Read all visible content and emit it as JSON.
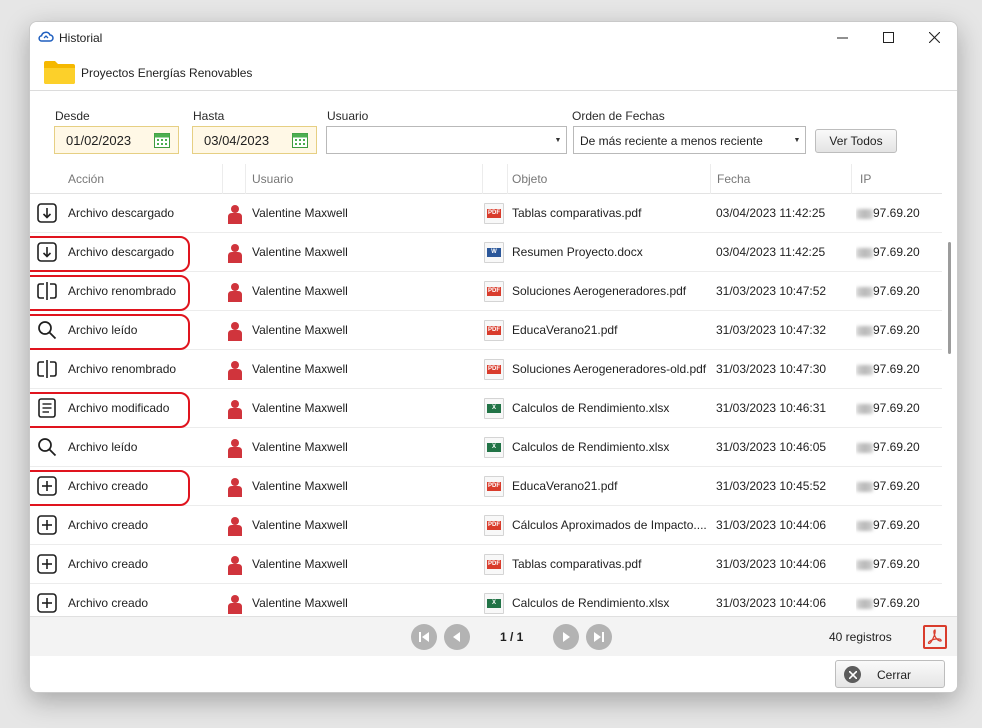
{
  "window": {
    "title": "Historial"
  },
  "folder": {
    "name": "Proyectos Energías Renovables"
  },
  "filters": {
    "desde_label": "Desde",
    "desde_value": "01/02/2023",
    "hasta_label": "Hasta",
    "hasta_value": "03/04/2023",
    "usuario_label": "Usuario",
    "usuario_value": "",
    "orden_label": "Orden de Fechas",
    "orden_value": "De más reciente a menos reciente",
    "ver_todos_label": "Ver Todos"
  },
  "table": {
    "headers": {
      "accion": "Acción",
      "usuario": "Usuario",
      "objeto": "Objeto",
      "fecha": "Fecha",
      "ip": "IP"
    },
    "rows": [
      {
        "action_icon": "download-icon",
        "accion": "Archivo descargado",
        "usuario": "Valentine Maxwell",
        "file_type": "pdf",
        "objeto": "Tablas comparativas.pdf",
        "fecha": "03/04/2023 11:42:25",
        "ip": "97.69.20",
        "highlighted": false
      },
      {
        "action_icon": "download-icon",
        "accion": "Archivo descargado",
        "usuario": "Valentine Maxwell",
        "file_type": "docx",
        "objeto": "Resumen Proyecto.docx",
        "fecha": "03/04/2023 11:42:25",
        "ip": "97.69.20",
        "highlighted": true
      },
      {
        "action_icon": "rename-icon",
        "accion": "Archivo renombrado",
        "usuario": "Valentine Maxwell",
        "file_type": "pdf",
        "objeto": "Soluciones Aerogeneradores.pdf",
        "fecha": "31/03/2023 10:47:52",
        "ip": "97.69.20",
        "highlighted": true
      },
      {
        "action_icon": "search-icon",
        "accion": "Archivo leído",
        "usuario": "Valentine Maxwell",
        "file_type": "pdf",
        "objeto": "EducaVerano21.pdf",
        "fecha": "31/03/2023 10:47:32",
        "ip": "97.69.20",
        "highlighted": true
      },
      {
        "action_icon": "rename-icon",
        "accion": "Archivo renombrado",
        "usuario": "Valentine Maxwell",
        "file_type": "pdf",
        "objeto": "Soluciones Aerogeneradores-old.pdf",
        "fecha": "31/03/2023 10:47:30",
        "ip": "97.69.20",
        "highlighted": false
      },
      {
        "action_icon": "document-icon",
        "accion": "Archivo modificado",
        "usuario": "Valentine Maxwell",
        "file_type": "xlsx",
        "objeto": "Calculos de Rendimiento.xlsx",
        "fecha": "31/03/2023 10:46:31",
        "ip": "97.69.20",
        "highlighted": true
      },
      {
        "action_icon": "search-icon",
        "accion": "Archivo leído",
        "usuario": "Valentine Maxwell",
        "file_type": "xlsx",
        "objeto": "Calculos de Rendimiento.xlsx",
        "fecha": "31/03/2023 10:46:05",
        "ip": "97.69.20",
        "highlighted": false
      },
      {
        "action_icon": "plus-icon",
        "accion": "Archivo creado",
        "usuario": "Valentine Maxwell",
        "file_type": "pdf",
        "objeto": "EducaVerano21.pdf",
        "fecha": "31/03/2023 10:45:52",
        "ip": "97.69.20",
        "highlighted": true
      },
      {
        "action_icon": "plus-icon",
        "accion": "Archivo creado",
        "usuario": "Valentine Maxwell",
        "file_type": "pdf",
        "objeto": "Cálculos Aproximados de Impacto....",
        "fecha": "31/03/2023 10:44:06",
        "ip": "97.69.20",
        "highlighted": false
      },
      {
        "action_icon": "plus-icon",
        "accion": "Archivo creado",
        "usuario": "Valentine Maxwell",
        "file_type": "pdf",
        "objeto": "Tablas comparativas.pdf",
        "fecha": "31/03/2023 10:44:06",
        "ip": "97.69.20",
        "highlighted": false
      },
      {
        "action_icon": "plus-icon",
        "accion": "Archivo creado",
        "usuario": "Valentine Maxwell",
        "file_type": "xlsx",
        "objeto": "Calculos de Rendimiento.xlsx",
        "fecha": "31/03/2023 10:44:06",
        "ip": "97.69.20",
        "highlighted": false
      }
    ]
  },
  "pager": {
    "page_indicator": "1 / 1",
    "record_count": "40 registros"
  },
  "footer": {
    "close_label": "Cerrar"
  },
  "colors": {
    "highlight": "#e0141e",
    "pdf": "#d93c2c",
    "docx": "#2b579a",
    "xlsx": "#217346",
    "user": "#d0343c",
    "calendar": "#4caf50"
  }
}
